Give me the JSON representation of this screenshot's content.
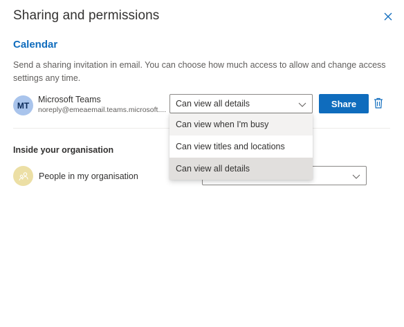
{
  "dialog": {
    "title": "Sharing and permissions",
    "close_icon": "close-icon"
  },
  "calendar": {
    "heading": "Calendar",
    "description": "Send a sharing invitation in email. You can choose how much access to allow and change access settings any time."
  },
  "shared_user": {
    "initials": "MT",
    "name": "Microsoft Teams",
    "email": "noreply@emeaemail.teams.microsoft....",
    "permission": "Can view all details",
    "share_label": "Share"
  },
  "dropdown": {
    "options": [
      "Can view when I'm busy",
      "Can view titles and locations",
      "Can view all details"
    ],
    "hovered_index": 0,
    "selected_index": 2
  },
  "organisation": {
    "heading": "Inside your organisation",
    "name": "People in my organisation"
  },
  "colors": {
    "accent": "#0f6cbd",
    "avatar_mt": "#a9c4ec",
    "avatar_org": "#ecdfa5"
  }
}
